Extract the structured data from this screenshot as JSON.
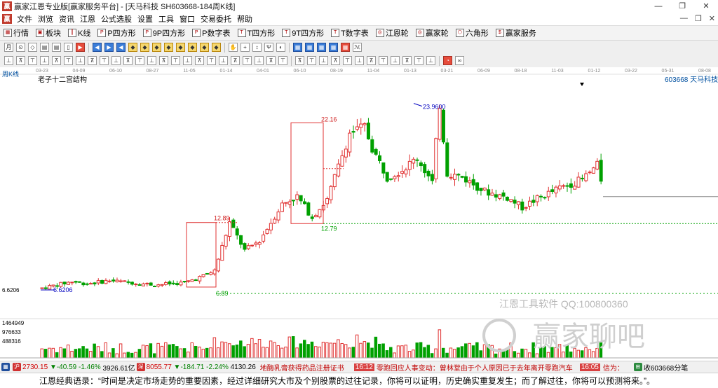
{
  "window": {
    "title": "赢家江恩专业版[赢家服务平台] - [天马科技  SH603668-184周K线]",
    "controls": [
      "—",
      "❐",
      "✕"
    ]
  },
  "menu": {
    "items": [
      "文件",
      "浏览",
      "资讯",
      "江恩",
      "公式选股",
      "设置",
      "工具",
      "窗口",
      "交易委托",
      "帮助"
    ],
    "mdi_controls": [
      "—",
      "❐",
      "✕"
    ]
  },
  "nav": {
    "items": [
      "行情",
      "板块",
      "K线",
      "P四方形",
      "9P四方形",
      "P数字表",
      "T四方形",
      "9T四方形",
      "T数字表",
      "江恩轮",
      "赢家轮",
      "六角形",
      "赢家服务"
    ]
  },
  "chart": {
    "period_label": "周K线",
    "structure_label": "老子十二宫结构",
    "stock_code": "603668",
    "stock_name": "天马科技",
    "date_ticks": [
      "03-23",
      "04-09",
      "06-10",
      "08-27",
      "11-05",
      "01-14",
      "04-01",
      "06-10",
      "08-19",
      "11-04",
      "01-13",
      "03-21",
      "06-09",
      "08-18",
      "11-03",
      "01-12",
      "03-22",
      "05-31",
      "08-08"
    ],
    "price_annotations": {
      "high_a": "12.89",
      "low_a": "6.89",
      "high_b": "22.16",
      "low_b": "12.79",
      "peak": "23.9600",
      "start_low": "6.6206",
      "axis_low": "6.6206"
    },
    "volume_ticks": [
      "1464949",
      "976633",
      "488316"
    ],
    "watermark": {
      "line1": "江恩工具软件   QQ:100800360",
      "line2": "赢家聊吧"
    },
    "colors": {
      "up": "#e03030",
      "down": "#00a000",
      "box": "#e03030",
      "grid": "#dddddd"
    }
  },
  "status": {
    "sh_index": "2730.15",
    "sh_change": "▼-40.59",
    "sh_pct": "-1.46%",
    "sh_amount": "3926.61亿",
    "sz_index": "8055.77",
    "sz_change": "▼-184.71",
    "sz_pct": "-2.24%",
    "sz_amount": "4130.26",
    "news1": "地酶乳膏获得药品注册证书",
    "news_time": "16:12",
    "news2": "零跑回应人事变动：曾林堂由于个人原因已于去年离开零跑汽车",
    "time2": "16:05",
    "news3": "信为：",
    "collect": "收603668分笔"
  },
  "quote": {
    "text": "江恩经典语录：“时间是决定市场走势的重要因素，经过详细研究大市及个别股票的过往记录，你将可以证明，历史确实重复发生；而了解过往，你将可以预测将来。”。"
  }
}
